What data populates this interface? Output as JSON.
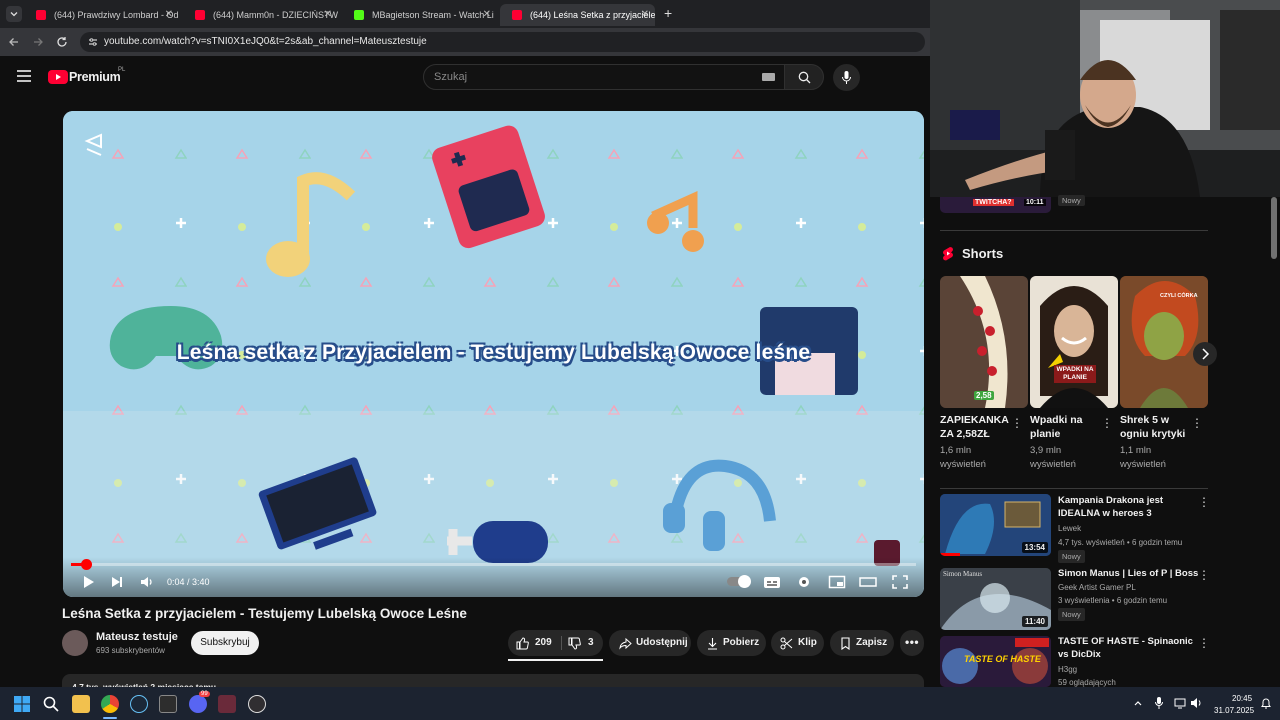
{
  "browser": {
    "tabs": [
      {
        "label": "(644) Prawdziwy Lombard - Od",
        "color": "#ff0033",
        "active": false
      },
      {
        "label": "(644) Mamm0n - DZIECIŃSTWO",
        "color": "#ff0033",
        "active": false
      },
      {
        "label": "MBagietson Stream - Watch Li",
        "color": "#53fc18",
        "active": false
      },
      {
        "label": "(644) Leśna Setka z przyjacielem",
        "color": "#ff0033",
        "active": true
      }
    ],
    "url": "youtube.com/watch?v=sTNI0X1eJQ0&t=2s&ab_channel=Mateusztestuje"
  },
  "yt_header": {
    "logo_text": "Premium",
    "logo_region": "PL",
    "search_placeholder": "Szukaj"
  },
  "player": {
    "overlay_title": "Leśna setka z Przyjacielem - Testujemy Lubelską Owoce leśne",
    "time": "0:04 / 3:40",
    "progress_fraction": 0.018
  },
  "video": {
    "title": "Leśna Setka z przyjacielem - Testujemy Lubelską Owoce Leśne",
    "channel": "Mateusz testuje",
    "subscribers": "693 subskrybentów",
    "subscribe_label": "Subskrybuj",
    "likes": "209",
    "dislikes": "3",
    "share_label": "Udostępnij",
    "download_label": "Pobierz",
    "clip_label": "Klip",
    "save_label": "Zapisz",
    "description_line": "4,7 tys. wyświetleń  2 miesiące temu"
  },
  "webcam": {
    "caption": "TWITCHA?",
    "timer": "10:11",
    "badge": "Nowy"
  },
  "shorts": {
    "heading": "Shorts",
    "items": [
      {
        "title": "ZAPIEKANKA ZA 2,58ZŁ",
        "views": "1,6 mln wyświetleń",
        "thumb_caption": "2,58"
      },
      {
        "title": "Wpadki na planie",
        "views": "3,9 mln wyświetleń",
        "thumb_caption": "WPADKI NA PLANIE"
      },
      {
        "title": "Shrek 5 w ogniu krytyki",
        "views": "1,1 mln wyświetleń",
        "thumb_caption": "CZYLI CÓRKA"
      }
    ]
  },
  "related": [
    {
      "title": "Kampania Drakona jest IDEALNA w heroes 3",
      "channel": "Lewek",
      "meta": "4,7 tys. wyświetleń • 6 godzin temu",
      "badge": "Nowy",
      "duration": "13:54"
    },
    {
      "title": "Simon Manus | Lies of P | Boss",
      "channel": "Geek Artist Gamer PL",
      "meta": "3 wyświetlenia • 6 godzin temu",
      "badge": "Nowy",
      "duration": "11:40",
      "thumb_caption": "Simon Manus"
    },
    {
      "title": "TASTE OF HASTE - Spinaonic vs DicDix",
      "channel": "H3gg",
      "meta": "59 oglądających",
      "badge": "",
      "duration": "",
      "thumb_caption": "TASTE OF HASTE"
    }
  ],
  "taskbar": {
    "time": "20:45",
    "date": "31.07.2025",
    "discord_badge": "99"
  }
}
